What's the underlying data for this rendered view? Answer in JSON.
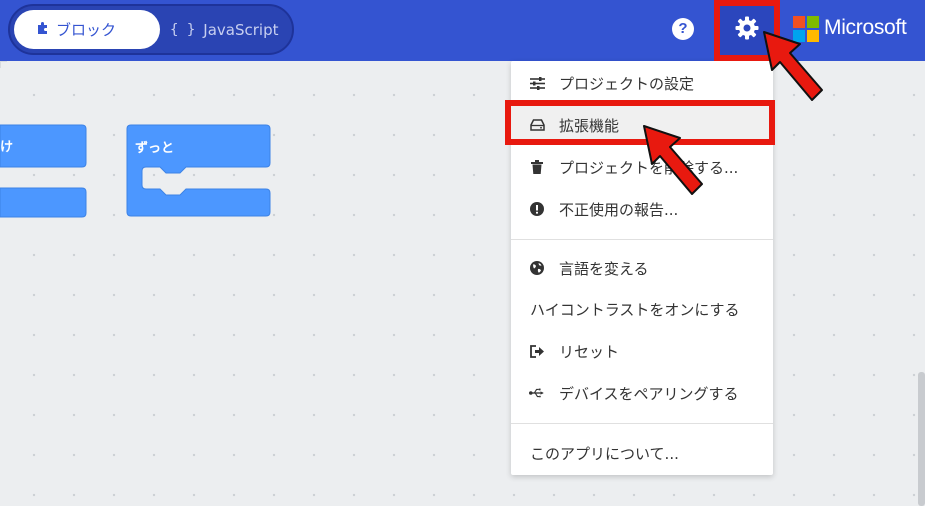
{
  "header": {
    "toggle": {
      "blocks_label": "ブロック",
      "js_braces": "{ }",
      "js_label": "JavaScript"
    },
    "help_glyph": "?",
    "brand": "Microsoft"
  },
  "workspace": {
    "blocks": [
      {
        "label": "け"
      },
      {
        "label": "ずっと"
      }
    ]
  },
  "menu": {
    "items": [
      {
        "label": "プロジェクトの設定",
        "icon": "sliders-icon"
      },
      {
        "label": "拡張機能",
        "icon": "drive-icon"
      },
      {
        "label": "プロジェクトを削除する...",
        "icon": "trash-icon"
      },
      {
        "label": "不正使用の報告...",
        "icon": "exclamation-circle-icon"
      },
      {
        "label": "言語を変える",
        "icon": "globe-icon"
      },
      {
        "label": "ハイコントラストをオンにする",
        "icon": ""
      },
      {
        "label": "リセット",
        "icon": "sign-out-icon"
      },
      {
        "label": "デバイスをペアリングする",
        "icon": "usb-icon"
      },
      {
        "label": "このアプリについて...",
        "icon": ""
      }
    ]
  },
  "colors": {
    "header_bg": "#3454d1",
    "block_blue": "#4c97ff",
    "annotation_red": "#e8190f",
    "ms_red": "#f25022",
    "ms_green": "#7fba00",
    "ms_blue": "#00a4ef",
    "ms_yellow": "#ffb900"
  }
}
